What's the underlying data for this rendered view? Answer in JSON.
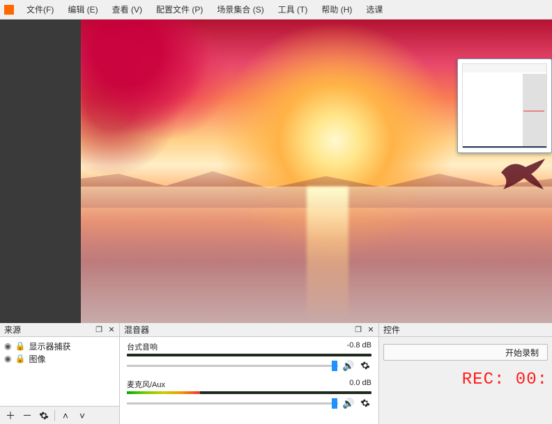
{
  "menu": {
    "items": [
      "文件(F)",
      "编辑 (E)",
      "查看 (V)",
      "配置文件 (P)",
      "场景集合 (S)",
      "工具 (T)",
      "帮助 (H)",
      "选课"
    ]
  },
  "sources": {
    "title": "来源",
    "items": [
      {
        "label": "显示器捕获"
      },
      {
        "label": "图像"
      }
    ]
  },
  "mixer": {
    "title": "混音器",
    "channels": [
      {
        "name": "台式音响",
        "db": "-0.8 dB",
        "meter_pct": 0,
        "slider_pct": 97
      },
      {
        "name": "麦克风/Aux",
        "db": "0.0 dB",
        "meter_pct": 30,
        "slider_pct": 97
      }
    ]
  },
  "controls": {
    "title": "控件",
    "start_recording": "开始录制",
    "rec_text": "REC: 00:"
  },
  "dock_buttons": {
    "pop": "❐",
    "close": "✕"
  }
}
